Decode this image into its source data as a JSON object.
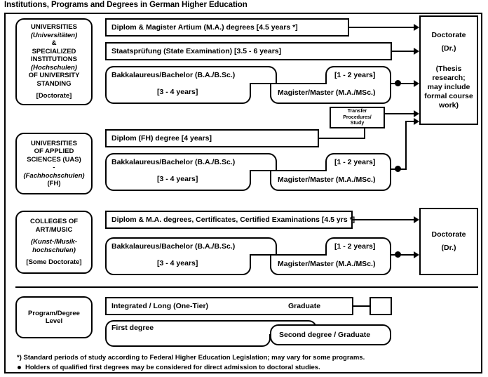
{
  "title": "Institutions, Programs and Degrees in German Higher Education",
  "sections": [
    {
      "id": "universities",
      "label_lines": [
        "UNIVERSITIES",
        "(Universitäten)",
        "&",
        "SPECIALIZED",
        "INSTITUTIONS",
        "(Hochschulen)",
        "OF UNIVERSITY",
        "STANDING"
      ],
      "label_bracket": "[Doctorate]",
      "rows": [
        {
          "id": "diplom-magister",
          "text": "Diplom & Magister Artium (M.A.) degrees [4.5 years *]"
        },
        {
          "id": "staatspruefung",
          "text": "Staatsprüfung (State Examination) [3.5 - 6 years]"
        },
        {
          "id": "bachelor",
          "text": "Bakkalaureus/Bachelor (B.A./B.Sc.)",
          "text2": "[3 - 4 years]"
        },
        {
          "id": "master",
          "text": "Magister/Master (M.A./MSc.)",
          "text2": "[1 - 2 years]"
        },
        {
          "id": "transfer",
          "text": "Transfer Procedures/ Study",
          "line1": "Transfer",
          "line2": "Procedures/",
          "line3": "Study"
        }
      ],
      "doctorate": {
        "line1": "Doctorate",
        "line2": "(Dr.)",
        "line3": "(Thesis",
        "line4": "research;",
        "line5": "may include",
        "line6": "formal course",
        "line7": "work)"
      }
    },
    {
      "id": "uas",
      "label_lines": [
        "UNIVERSITIES",
        "OF APPLIED",
        "SCIENCES (UAS)",
        "-",
        "(Fachhochschulen)",
        "(FH)"
      ],
      "rows": [
        {
          "id": "diplom-fh",
          "text": "Diplom (FH) degree [4 years]"
        },
        {
          "id": "bachelor-fh",
          "text": "Bakkalaureus/Bachelor (B.A./B.Sc.)",
          "text2": "[3 - 4 years]"
        },
        {
          "id": "master-fh",
          "text": "Magister/Master (M.A./MSc.)",
          "text2": "[1 - 2 years]"
        }
      ]
    },
    {
      "id": "art-music",
      "label_lines": [
        "COLLEGES OF",
        "ART/MUSIC",
        "(Kunst-/Musik-",
        "hochschulen)"
      ],
      "label_bracket": "[Some Doctorate]",
      "rows": [
        {
          "id": "diplom-ma",
          "text": "Diplom & M.A. degrees, Certificates, Certified Examinations [4.5 yrs *]"
        },
        {
          "id": "bachelor-am",
          "text": "Bakkalaureus/Bachelor (B.A./B.Sc.)",
          "text2": "[3 - 4 years]"
        },
        {
          "id": "master-am",
          "text": "Magister/Master (M.A./MSc.)",
          "text2": "[1 - 2 years]"
        }
      ],
      "doctorate": {
        "line1": "Doctorate",
        "line2": "(Dr.)"
      }
    },
    {
      "id": "program-degree-level",
      "label_lines": [
        "Program/Degree",
        "Level"
      ],
      "rows": [
        {
          "id": "integrated",
          "text": "Integrated / Long (One-Tier)",
          "text2": "Graduate"
        },
        {
          "id": "first-degree",
          "text": "First degree"
        },
        {
          "id": "second-degree",
          "text": "Second degree / Graduate"
        }
      ]
    }
  ],
  "footnotes": {
    "asterisk": "*) Standard periods of study according to Federal Higher Education Legislation; may vary for some programs.",
    "bullet": "Holders of qualified first degrees may be considered for direct admission to doctoral studies."
  }
}
